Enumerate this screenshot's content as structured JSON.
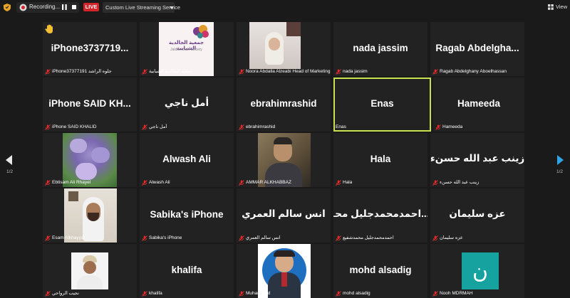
{
  "toolbar": {
    "recording_label": "Recording...",
    "live_label": "LIVE",
    "stream_label": "Custom Live Streaming Service",
    "view_label": "View"
  },
  "pagination": {
    "left": "1/2",
    "right": "1/2"
  },
  "colors": {
    "live": "#d4242a",
    "active_border": "#c6e24c",
    "next_arrow": "#2fa5e8",
    "tile_bg": "#222222",
    "mute_icon": "#e02b2b"
  },
  "hand_icon": "raised-hand-icon",
  "tiles": [
    {
      "name": "iPhone3737719...",
      "label": "iPhone37377191 جلوه الراشد"
    },
    {
      "name": "",
      "label": "جمعية الجالدية الشبابية",
      "logo_text": "جمعية الجالدية الشبابية",
      "logo_sub": "Jaldia Youth Society"
    },
    {
      "name": "",
      "label": "Noora Abdalla Alzeabi Head of Marketing"
    },
    {
      "name": "nada jassim",
      "label": "nada jassim"
    },
    {
      "name": "Ragab  Abdelgha...",
      "label": "Ragab Abdelghany Aboelhassan"
    },
    {
      "name": "iPhone SAID KH...",
      "label": "iPhone SAID KHALID"
    },
    {
      "name": "أمل ناجي",
      "label": "أمل ناجي"
    },
    {
      "name": "ebrahimrashid",
      "label": "ebrahimrashid"
    },
    {
      "name": "Enas",
      "label": "Enas"
    },
    {
      "name": "Hameeda",
      "label": "Hameeda"
    },
    {
      "name": "",
      "label": "Ebtisam Ali Rhayel"
    },
    {
      "name": "Alwash Ali",
      "label": "Alwash Ali"
    },
    {
      "name": "",
      "label": "AMMAR ALKHABBAZ"
    },
    {
      "name": "Hala",
      "label": "Hala"
    },
    {
      "name": "زينب عبد الله حسنء",
      "label": "زينب عبد الله حسنء"
    },
    {
      "name": "",
      "label": "Esam Alkhayyat"
    },
    {
      "name": "Sabika's iPhone",
      "label": "Sabika's iPhone"
    },
    {
      "name": "انس سالم العمري",
      "label": "انس سالم العمري"
    },
    {
      "name": "احمدمحمدجليل  محـ...",
      "label": "احمدمحمدجليل محمدشفيع"
    },
    {
      "name": "عزه سليمان",
      "label": "عزه سليمان"
    },
    {
      "name": "",
      "label": "نجيب الرواحي"
    },
    {
      "name": "khalifa",
      "label": "khalifa"
    },
    {
      "name": "",
      "label": "Muhammad"
    },
    {
      "name": "mohd alsadig",
      "label": "mohd alsadig"
    },
    {
      "name": "",
      "label": "Nooh MDRMAH",
      "avatar_text": "ن"
    }
  ]
}
